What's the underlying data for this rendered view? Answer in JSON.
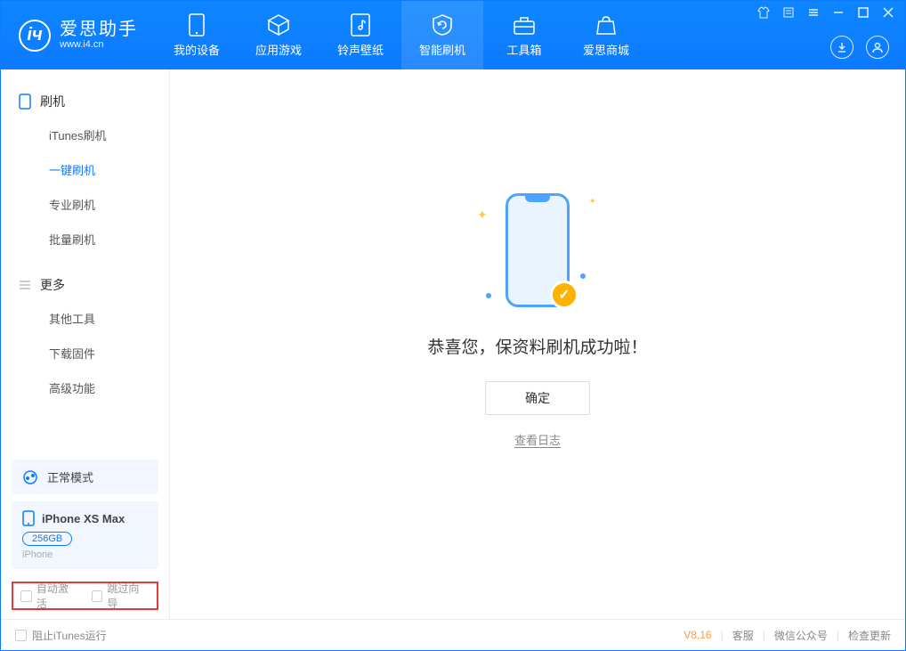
{
  "logo": {
    "title": "爱思助手",
    "subtitle": "www.i4.cn"
  },
  "nav": [
    {
      "label": "我的设备"
    },
    {
      "label": "应用游戏"
    },
    {
      "label": "铃声壁纸"
    },
    {
      "label": "智能刷机"
    },
    {
      "label": "工具箱"
    },
    {
      "label": "爱思商城"
    }
  ],
  "sidebar": {
    "group1_label": "刷机",
    "items1": [
      {
        "label": "iTunes刷机"
      },
      {
        "label": "一键刷机"
      },
      {
        "label": "专业刷机"
      },
      {
        "label": "批量刷机"
      }
    ],
    "group2_label": "更多",
    "items2": [
      {
        "label": "其他工具"
      },
      {
        "label": "下载固件"
      },
      {
        "label": "高级功能"
      }
    ]
  },
  "device": {
    "status": "正常模式",
    "name": "iPhone XS Max",
    "capacity": "256GB",
    "type": "iPhone"
  },
  "bottom_checks": {
    "auto_activate": "自动激活",
    "skip_guide": "跳过向导"
  },
  "main": {
    "success_text": "恭喜您，保资料刷机成功啦！",
    "confirm_label": "确定",
    "log_link": "查看日志"
  },
  "footer": {
    "block_itunes": "阻止iTunes运行",
    "version": "V8.16",
    "support": "客服",
    "wechat": "微信公众号",
    "update": "检查更新"
  }
}
